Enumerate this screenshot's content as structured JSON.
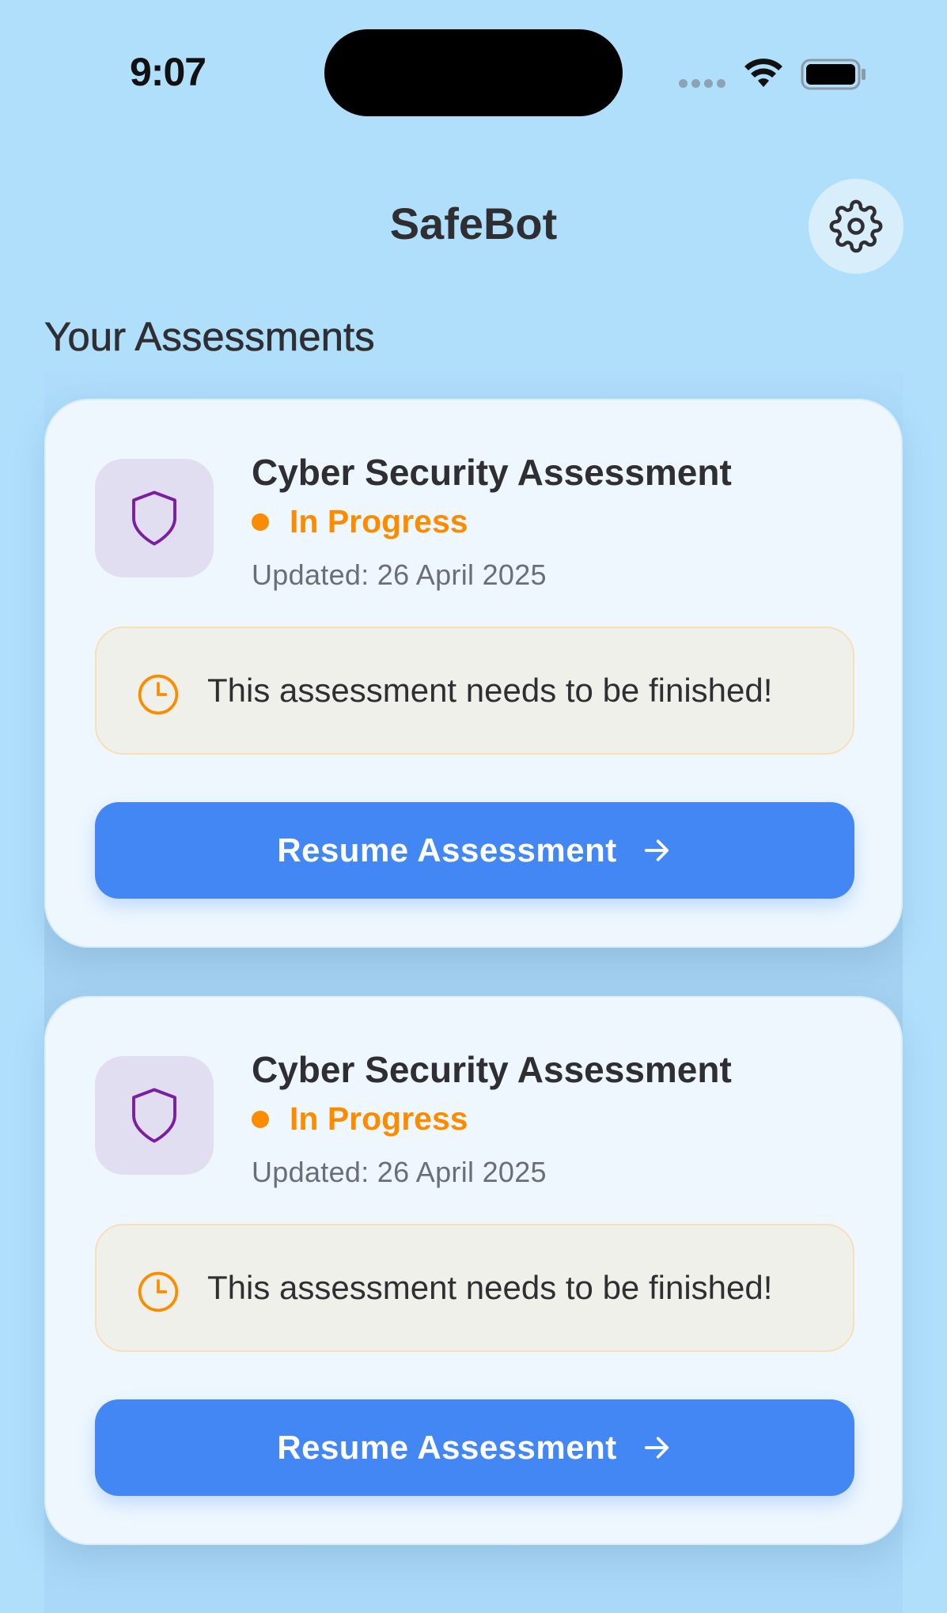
{
  "status_bar": {
    "time": "9:07"
  },
  "header": {
    "title": "SafeBot",
    "settings_icon": "gear-icon"
  },
  "section": {
    "title": "Your Assessments"
  },
  "colors": {
    "background": "#b0dffc",
    "card": "#eef7fe",
    "accent_blue": "#4387f5",
    "status_orange": "#fb8c00",
    "shield_purple": "#7b1fa2"
  },
  "assessments": [
    {
      "icon": "shield-icon",
      "title": "Cyber Security Assessment",
      "status": "In Progress",
      "updated": "Updated: 26 April 2025",
      "notice_icon": "clock-icon",
      "notice": "This assessment needs to be finished!",
      "button_label": "Resume Assessment",
      "button_icon": "arrow-right-icon"
    },
    {
      "icon": "shield-icon",
      "title": "Cyber Security Assessment",
      "status": "In Progress",
      "updated": "Updated: 26 April 2025",
      "notice_icon": "clock-icon",
      "notice": "This assessment needs to be finished!",
      "button_label": "Resume Assessment",
      "button_icon": "arrow-right-icon"
    }
  ]
}
